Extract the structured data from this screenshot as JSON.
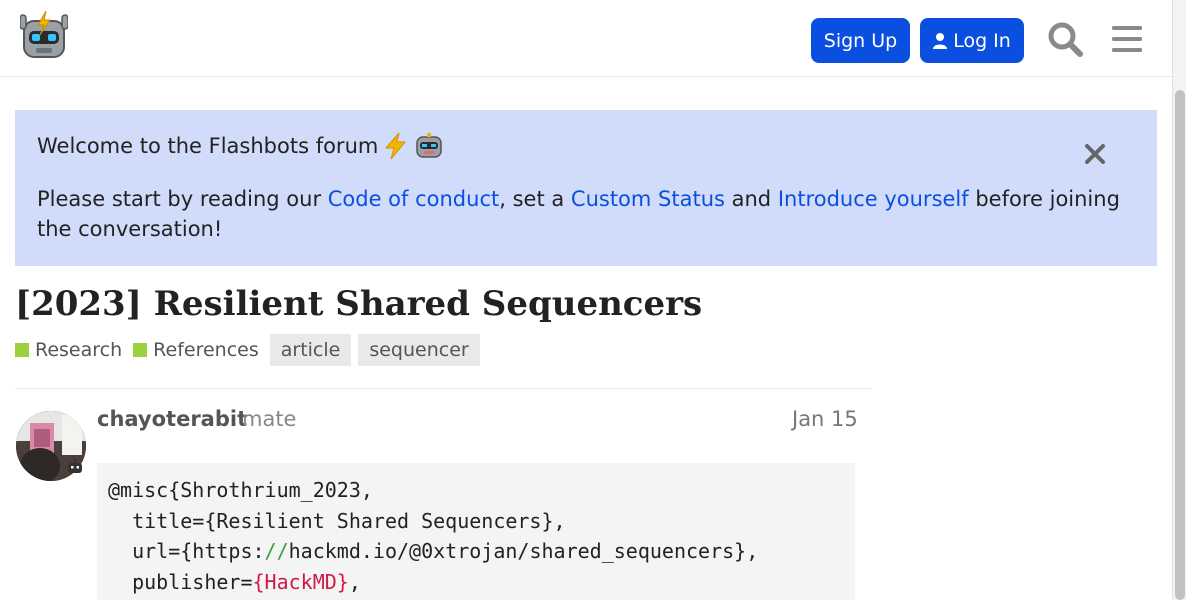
{
  "header": {
    "signup_label": "Sign Up",
    "login_label": "Log In"
  },
  "banner": {
    "title": "Welcome to the Flashbots forum",
    "text_part1": "Please start by reading our ",
    "link_code_of_conduct": "Code of conduct",
    "text_part2": ", set a ",
    "link_custom_status": "Custom Status",
    "text_part3": " and ",
    "link_introduce": "Introduce yourself",
    "text_part4": " before joining the conversation!"
  },
  "topic": {
    "title": "[2023] Resilient Shared Sequencers",
    "categories": [
      "Research",
      "References"
    ],
    "tags": [
      "article",
      "sequencer"
    ]
  },
  "post": {
    "username": "chayoterabit",
    "user_title": "mate",
    "date": "Jan 15",
    "code": {
      "line1": "@misc{Shrothrium_2023,",
      "line2": "  title={Resilient Shared Sequencers},",
      "line3_a": "  url={https:",
      "line3_b": "//",
      "line3_c": "hackmd.io/@0xtrojan/shared_sequencers},",
      "line4_a": "  publisher=",
      "line4_b": "{HackMD}",
      "line4_c": ","
    }
  },
  "colors": {
    "accent": "#0a4fe0",
    "banner_bg": "#d1dcfa",
    "category": "#9ccf3c"
  }
}
